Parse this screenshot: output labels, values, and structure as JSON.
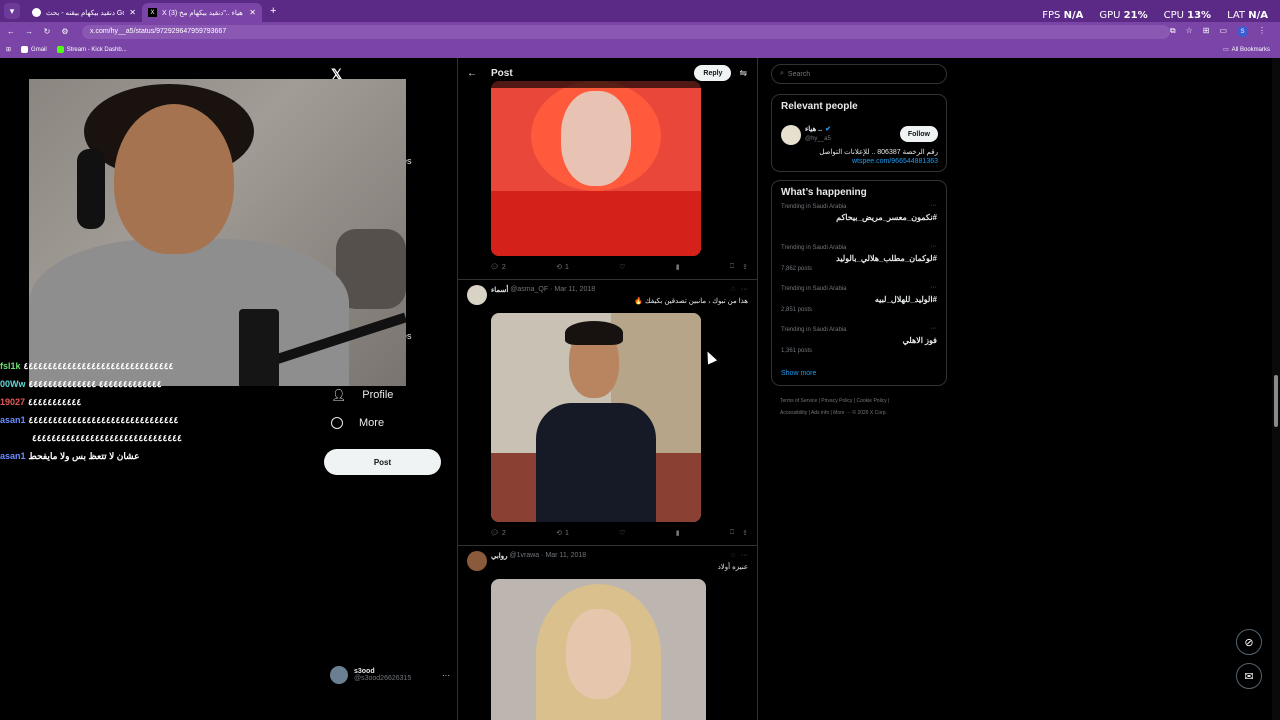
{
  "browser": {
    "tabs": [
      {
        "label": "دنقيد بيكهام بيقنه - بحث Google",
        "active": false
      },
      {
        "label": "X على هياء ..\"دنقيد بيكهام مخ (3)\"",
        "active": true
      }
    ],
    "new_tab": "+",
    "url": "x.com/hy__a5/status/972929647959793667",
    "bookmarks": [
      "Gmail",
      "Stream - Kick Dashb...",
      "All Bookmarks"
    ],
    "profile_initial": "S"
  },
  "overlay": {
    "fps_label": "FPS",
    "fps_value": "N/A",
    "gpu_label": "GPU",
    "gpu_value": "21%",
    "cpu_label": "CPU",
    "cpu_value": "13%",
    "lat_label": "LAT",
    "lat_value": "N/A"
  },
  "chat": [
    {
      "user": "fsl1k",
      "msg": "٤٤٤٤٤٤٤٤٤٤٤٤٤٤٤٤٤٤٤٤٤٤٤٤٤٤٤٤٤٤٤",
      "color": "#6fe06f"
    },
    {
      "user": "00Ww",
      "msg": "٤٤٤٤٤٤٤٤٤٤٤٤٤ ٤٤٤٤٤٤٤٤٤٤٤٤٤٤",
      "color": "#5fd7d7"
    },
    {
      "user": "19027",
      "msg": "٤٤٤٤٤٤٤٤٤٤٤",
      "color": "#e05a5a"
    },
    {
      "user": "asan1",
      "msg": "٤٤٤٤٤٤٤٤٤٤٤٤٤٤٤٤٤٤٤٤٤٤٤٤٤٤٤٤٤٤٤",
      "color": "#6a8cff"
    },
    {
      "user": "",
      "msg": "٤٤٤٤٤٤٤٤٤٤٤٤٤٤٤٤٤٤٤٤٤٤٤٤٤٤٤٤٤٤٤",
      "color": "#6a8cff"
    },
    {
      "user": "asan1",
      "msg": "عشان لا تتعظ بس ولا مايفحط",
      "color": "#6a8cff"
    }
  ],
  "left_nav": {
    "partial_1": "es",
    "partial_2": "es",
    "profile": "Profile",
    "more": "More",
    "post": "Post",
    "account_name": "s3ood",
    "account_handle": "@s3ood26626315",
    "account_more": "···"
  },
  "main": {
    "header_title": "Post",
    "back": "←",
    "reply": "Reply",
    "posts": [
      {
        "name": "",
        "handle": "",
        "date": "",
        "text": "",
        "replies": "2",
        "reposts": "1"
      },
      {
        "name": "أسماء",
        "handle": "@asma_QF",
        "date": "· Mar 11, 2018",
        "text": "هذا من تبوك ، مانبين تصدقين بكيفك 🔥",
        "replies": "2",
        "reposts": "1"
      },
      {
        "name": "روابي",
        "handle": "@1vrawa",
        "date": "· Mar 11, 2018",
        "text": "عنيزه أولاد",
        "replies": "",
        "reposts": ""
      }
    ]
  },
  "right": {
    "search_placeholder": "Search",
    "relevant_title": "Relevant people",
    "person_name": "هياء ..",
    "person_handle": "@hy__a5",
    "follow": "Follow",
    "person_bio": "رقم الرخصة 806387 .. للإعلانات التواصل",
    "person_link": "wtspee.com/966544881363",
    "happening_title": "What’s happening",
    "trends": [
      {
        "cat": "Trending in Saudi Arabia",
        "tag": "#نكمون_معسر_مريض_بيحاكم",
        "count": ""
      },
      {
        "cat": "Trending in Saudi Arabia",
        "tag": "#لوكمان_مطلب_هلالي_بالوليد",
        "count": "7,862 posts"
      },
      {
        "cat": "Trending in Saudi Arabia",
        "tag": "#الوليد_للهلال_لبيه",
        "count": "2,851 posts"
      },
      {
        "cat": "Trending in Saudi Arabia",
        "tag": "فوز الاهلي",
        "count": "1,361 posts"
      }
    ],
    "show_more": "Show more",
    "footer_1": "Terms of Service  |  Privacy Policy  |  Cookie Policy  |",
    "footer_2": "Accessibility  |  Ads info  |  More ···  © 2026 X Corp."
  },
  "colors": {
    "accent": "#1d9bf0",
    "browser": "#7a45a6",
    "verified": "#1d9bf0"
  }
}
